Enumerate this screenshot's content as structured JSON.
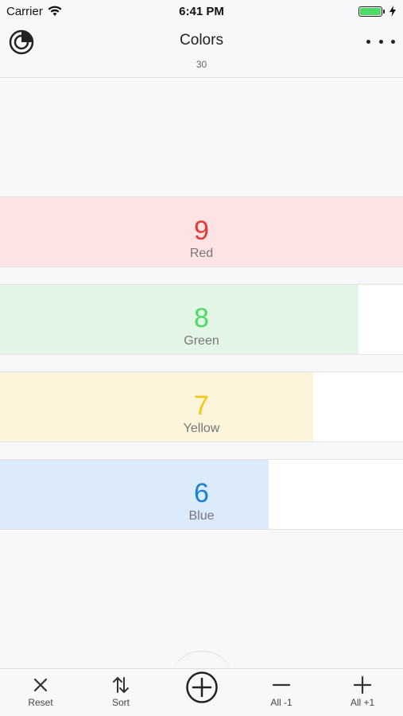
{
  "status_bar": {
    "carrier": "Carrier",
    "time": "6:41 PM",
    "battery_level": 1.0
  },
  "nav": {
    "title": "Colors",
    "subtitle": "30",
    "left_icon": "counter-logo-icon",
    "right_icon": "more-icon"
  },
  "counters": [
    {
      "count": "9",
      "label": "Red",
      "fraction": 1.0,
      "fill_color": "#fde3e3",
      "count_color": "#e53935"
    },
    {
      "count": "8",
      "label": "Green",
      "fraction": 0.889,
      "fill_color": "#e3f6e5",
      "count_color": "#4cd964"
    },
    {
      "count": "7",
      "label": "Yellow",
      "fraction": 0.778,
      "fill_color": "#fdf4dc",
      "count_color": "#f5c518"
    },
    {
      "count": "6",
      "label": "Blue",
      "fraction": 0.667,
      "fill_color": "#dcebfc",
      "count_color": "#1a7fd8"
    }
  ],
  "toolbar": {
    "reset_label": "Reset",
    "sort_label": "Sort",
    "add_icon": "plus-circle-icon",
    "all_minus_label": "All -1",
    "all_plus_label": "All +1"
  }
}
